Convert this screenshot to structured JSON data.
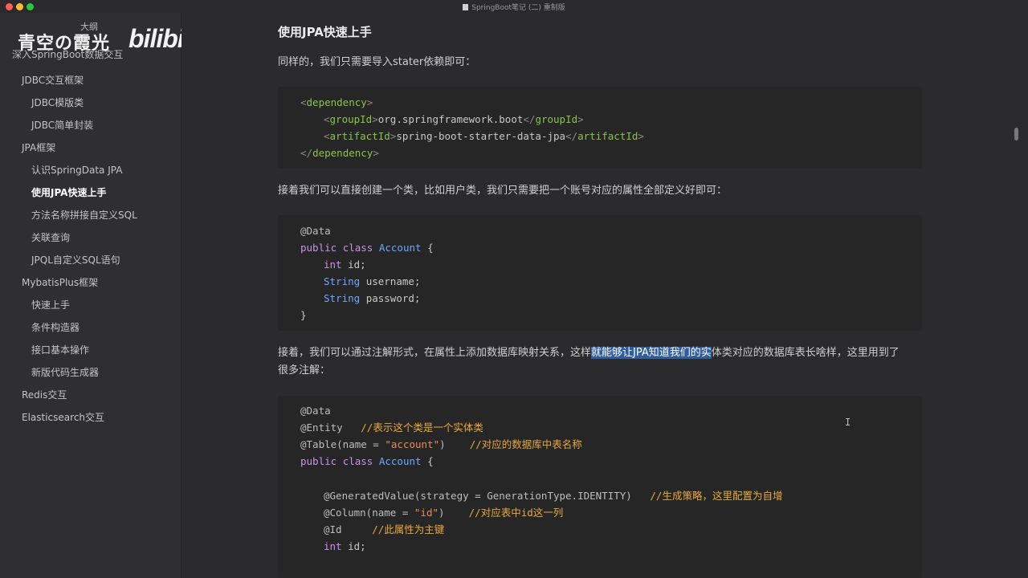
{
  "window": {
    "title": "SpringBoot笔记 (二) 重制版"
  },
  "watermark": {
    "name": "青空の霞光",
    "logo": "bilibili"
  },
  "sidebar": {
    "outline_label": "大纲",
    "first_item": "深入SpringBoot数据交互",
    "items": [
      {
        "label": "JDBC交互框架",
        "level": 1
      },
      {
        "label": "JDBC模版类",
        "level": 2
      },
      {
        "label": "JDBC简单封装",
        "level": 2
      },
      {
        "label": "JPA框架",
        "level": 1
      },
      {
        "label": "认识SpringData JPA",
        "level": 2
      },
      {
        "label": "使用JPA快速上手",
        "level": 2,
        "active": true
      },
      {
        "label": "方法名称拼接自定义SQL",
        "level": 2
      },
      {
        "label": "关联查询",
        "level": 2
      },
      {
        "label": "JPQL自定义SQL语句",
        "level": 2
      },
      {
        "label": "MybatisPlus框架",
        "level": 1
      },
      {
        "label": "快速上手",
        "level": 2
      },
      {
        "label": "条件构造器",
        "level": 2
      },
      {
        "label": "接口基本操作",
        "level": 2
      },
      {
        "label": "新版代码生成器",
        "level": 2
      },
      {
        "label": "Redis交互",
        "level": 1
      },
      {
        "label": "Elasticsearch交互",
        "level": 1
      }
    ]
  },
  "content": {
    "heading": "使用JPA快速上手",
    "para1": "同样的，我们只需要导入stater依赖即可：",
    "code1": {
      "open_tag": "dependency",
      "group_tag": "groupId",
      "group_value": "org.springframework.boot",
      "artifact_tag": "artifactId",
      "artifact_value": "spring-boot-starter-data-jpa"
    },
    "para2": "接着我们可以直接创建一个类，比如用户类，我们只需要把一个账号对应的属性全部定义好即可：",
    "code2": {
      "annotation": "@Data",
      "kw_public": "public",
      "kw_class": "class",
      "class_name": "Account",
      "open_brace": "{",
      "int_type": "int",
      "id_field": "id;",
      "string_type": "String",
      "username_field": "username;",
      "password_field": "password;",
      "close_brace": "}"
    },
    "para3": {
      "before": "接着，我们可以通过注解形式，在属性上添加数据库映射关系，这样",
      "highlight": "就能够让JPA知道我们的实",
      "after": "体类对应的数据库表长啥样，这里用到了",
      "line2": "很多注解："
    },
    "code3": {
      "data_ann": "@Data",
      "entity_ann": "@Entity",
      "entity_comment": "//表示这个类是一个实体类",
      "table_ann_open": "@Table(name = ",
      "table_name": "\"account\"",
      "table_close": ")",
      "table_comment": "//对应的数据库中表名称",
      "kw_public": "public",
      "kw_class": "class",
      "class_name": "Account",
      "open_brace": "{",
      "gen_ann": "@GeneratedValue(strategy = GenerationType.IDENTITY)",
      "gen_comment": "//生成策略，这里配置为自增",
      "col_ann_open": "@Column(name = ",
      "col_name": "\"id\"",
      "col_close": ")",
      "col_comment": "//对应表中id这一列",
      "id_ann": "@Id",
      "id_comment": "//此属性为主键",
      "int_type": "int",
      "id_field": "id;"
    },
    "cursor_glyph": "I"
  }
}
